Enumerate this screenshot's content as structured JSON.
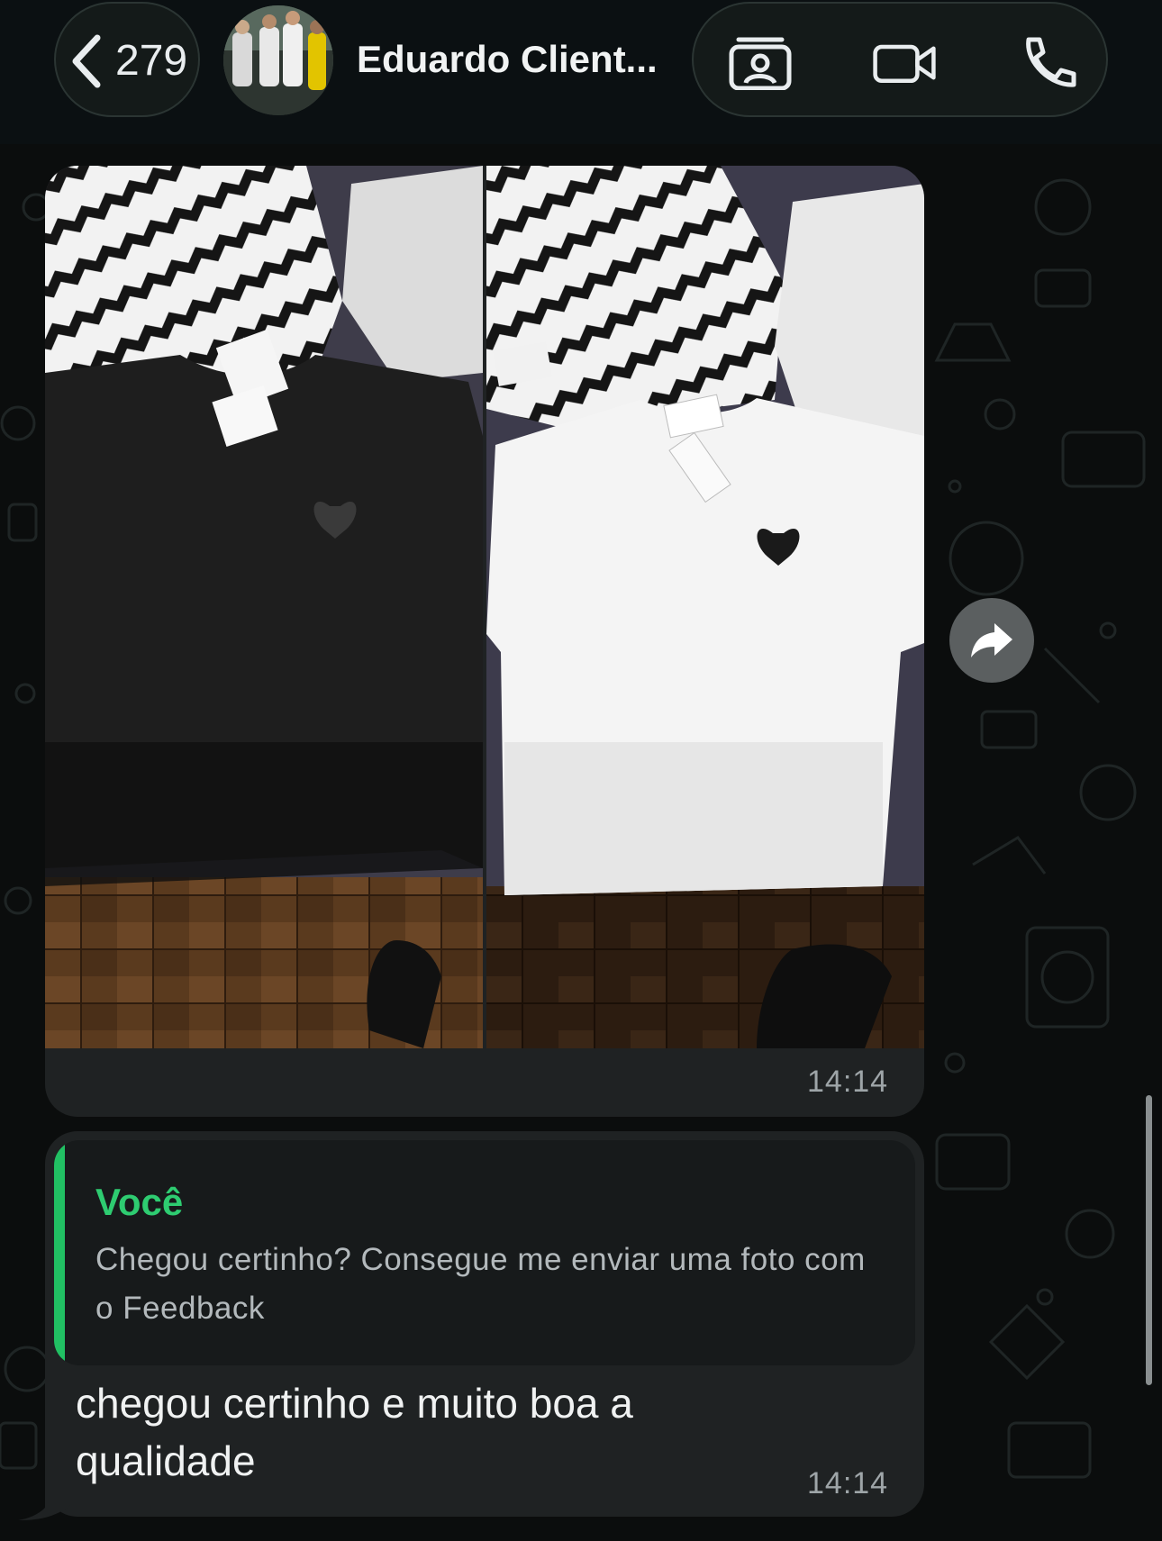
{
  "header": {
    "back_count": "279",
    "contact_name": "Eduardo Client...",
    "icons": [
      "chevron-left-icon",
      "contact-card-icon",
      "video-camera-icon",
      "phone-icon"
    ]
  },
  "messages": [
    {
      "type": "media",
      "photos": [
        "black t-shirt photo",
        "white t-shirt photo"
      ],
      "time": "14:14"
    },
    {
      "type": "text",
      "quote": {
        "author": "Você",
        "text": "Chegou certinho? Consegue me enviar uma foto com o Feedback"
      },
      "text": "chegou certinho e muito boa a qualidade",
      "time": "14:14"
    }
  ],
  "colors": {
    "background": "#0b0d0d",
    "bubble": "#1f2223",
    "quote_accent": "#21c063",
    "quote_author": "#2ecc71"
  }
}
